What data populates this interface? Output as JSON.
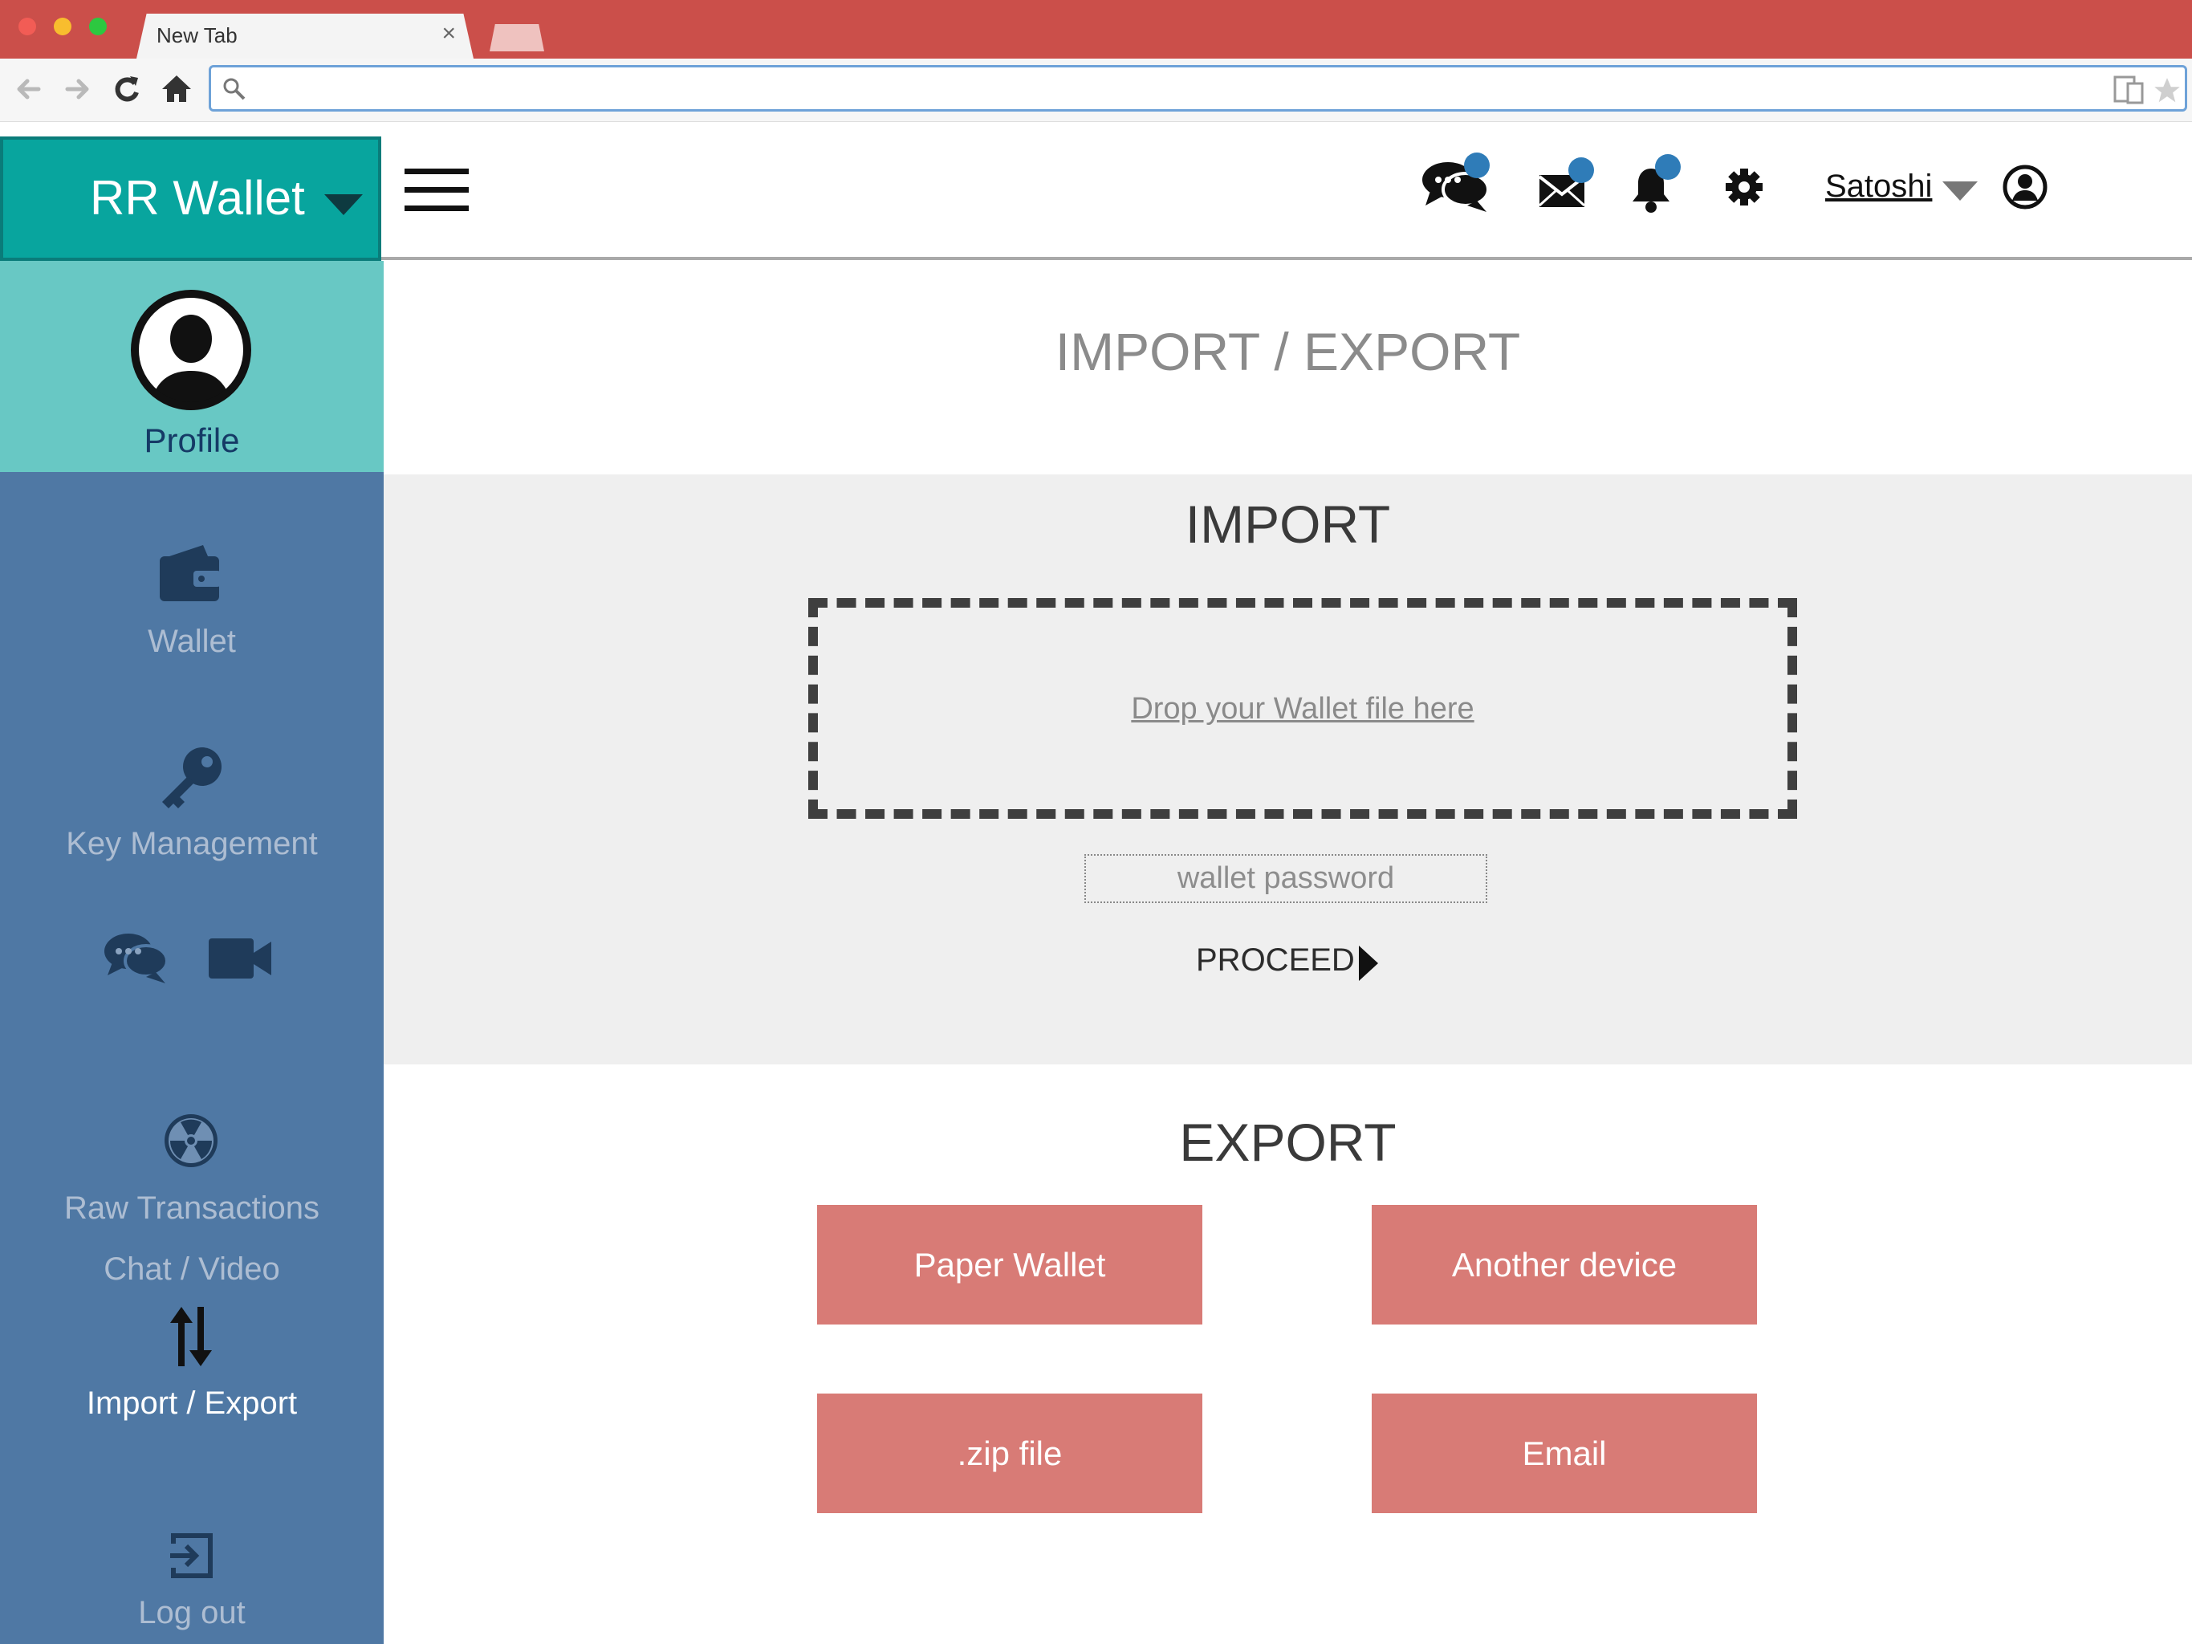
{
  "browser": {
    "tab_title": "New Tab",
    "tab_close": "×",
    "url_value": ""
  },
  "header": {
    "brand": "RR Wallet",
    "user_name": "Satoshi",
    "icons": [
      "chat-icon",
      "mail-icon",
      "bell-icon",
      "gear-icon",
      "user-circle-icon"
    ]
  },
  "sidebar": {
    "profile_label": "Profile",
    "items": [
      {
        "label": "Wallet",
        "icon": "wallet-icon"
      },
      {
        "label": "Key Management",
        "icon": "key-icon"
      },
      {
        "label": "Chat / Video",
        "icon": "chat-video-icon"
      },
      {
        "label": "Raw Transactions",
        "icon": "radiation-icon"
      },
      {
        "label": "Import / Export",
        "icon": "import-export-icon",
        "active": true
      },
      {
        "label": "Log out",
        "icon": "logout-icon"
      }
    ]
  },
  "main": {
    "title": "IMPORT / EXPORT",
    "import": {
      "heading": "IMPORT",
      "dropzone_text": "Drop your Wallet file here",
      "password_placeholder": "wallet password",
      "proceed_label": "PROCEED"
    },
    "export": {
      "heading": "EXPORT",
      "buttons": [
        "Paper Wallet",
        "Another device",
        ".zip file",
        "Email"
      ]
    }
  },
  "colors": {
    "titlebar": "#cb4f4a",
    "brand": "#08a59e",
    "sidebar": "#4f78a4",
    "profile": "#68c8c4",
    "export_button": "#d87b76",
    "badge": "#2f7cb8"
  }
}
